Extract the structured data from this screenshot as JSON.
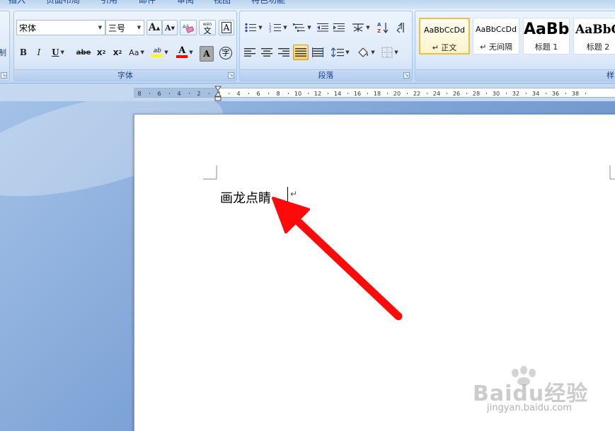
{
  "tabs": [
    "插入",
    "页面布局",
    "引用",
    "邮件",
    "审阅",
    "视图",
    "特色功能"
  ],
  "ribbon": {
    "clipboard_partial_label": "制",
    "font_group": {
      "label": "字体",
      "font_name": "宋体",
      "font_size": "三号",
      "grow_label": "A",
      "shrink_label": "A",
      "wen_label": "文",
      "phonetic_label": "A",
      "bold": "B",
      "italic": "I",
      "underline": "U",
      "strike": "abe",
      "subscript": "x",
      "superscript": "x",
      "change_case": "Aa",
      "highlight": "ab",
      "font_color": "A",
      "char_shading": "A",
      "enclose": "字"
    },
    "paragraph_group": {
      "label": "段落"
    },
    "styles_group": {
      "label": "样",
      "tiles": [
        {
          "sample": "AaBbCcDd",
          "name": "↵ 正文"
        },
        {
          "sample": "AaBbCcDd",
          "name": "↵ 无间隔"
        },
        {
          "sample": "AaBb",
          "name": "标题 1"
        },
        {
          "sample": "AaBbC",
          "name": "标题 2"
        }
      ]
    }
  },
  "ruler": {
    "ticks": [
      "8",
      "6",
      "4",
      "2",
      "2",
      "4",
      "6",
      "8",
      "10",
      "12",
      "14",
      "16",
      "18",
      "20",
      "22",
      "24",
      "26",
      "28",
      "30",
      "32",
      "34",
      "36",
      "38"
    ]
  },
  "document": {
    "text": "画龙点睛",
    "paragraph_mark": "↵"
  },
  "watermark": {
    "logo": "Baidu经验",
    "url": "jingyan.baidu.com"
  },
  "colors": {
    "annotation_arrow": "#ff0a0a",
    "highlight_yellow": "#ffff00",
    "font_color_red": "#ff0000"
  }
}
